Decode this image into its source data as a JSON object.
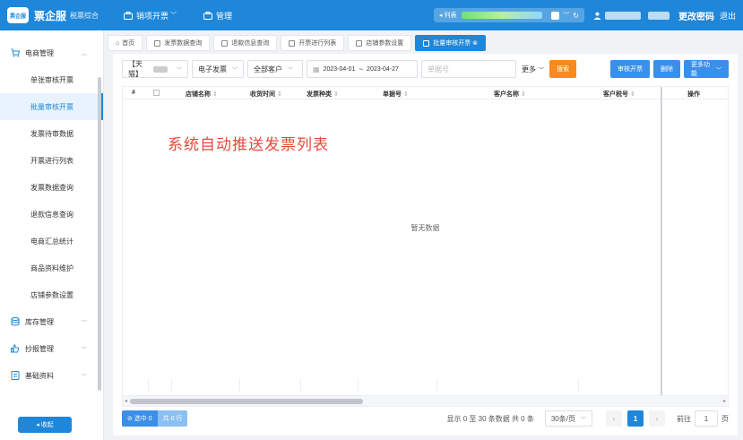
{
  "header": {
    "logo_text": "票企服",
    "app_name": "票企服",
    "app_sub": "税票综合",
    "nav": [
      {
        "label": "销项开票",
        "icon": "briefcase-icon",
        "caret": "﹀"
      },
      {
        "label": "管理",
        "icon": "briefcase-icon"
      }
    ],
    "list_label": "◂ 列表",
    "change_pwd": "更改密码",
    "logout": "退出"
  },
  "sidebar": {
    "groups": [
      {
        "label": "电商管理",
        "icon": "cart-icon",
        "items": [
          "单张审核开票",
          "批量审核开票",
          "发票待审数据",
          "开票进行列表",
          "发票数据查询",
          "退款信息查询",
          "电商汇总统计",
          "商品资料维护",
          "店铺参数设置"
        ]
      },
      {
        "label": "库存管理",
        "icon": "database-icon"
      },
      {
        "label": "抄报管理",
        "icon": "hand-icon"
      },
      {
        "label": "基础资料",
        "icon": "doc-icon"
      }
    ],
    "active_item": "批量审核开票",
    "collapse_label": "◂ 收起"
  },
  "tabs": [
    {
      "label": "首页",
      "active": false
    },
    {
      "label": "发票数据查询",
      "active": false
    },
    {
      "label": "退款信息查询",
      "active": false
    },
    {
      "label": "开票进行列表",
      "active": false
    },
    {
      "label": "店铺参数设置",
      "active": false
    },
    {
      "label": "批量审核开票 ⊗",
      "active": true
    }
  ],
  "filters": {
    "shop": "【天猫】",
    "invoice_type": "电子发票",
    "customer": "全部客户",
    "date_from": "2023-04-01",
    "date_sep": "~",
    "date_to": "2023-04-27",
    "order_placeholder": "单据号",
    "more": "更多",
    "search": "搜索",
    "audit_btn": "审核开票",
    "delete_btn": "删除",
    "more_btn": "更多功能"
  },
  "table": {
    "columns": [
      "#",
      "店铺名称",
      "收货时间",
      "发票种类",
      "单据号",
      "客户名称",
      "客户税号",
      "操作"
    ],
    "empty": "暂无数据",
    "overlay": "系统自动推送发票列表"
  },
  "footer": {
    "selected": "⊘ 选中 0",
    "total_rows": "共 0 行",
    "summary": "显示 0 至 30 条数据  共 0 条",
    "page_size": "30条/页",
    "current_page": "1",
    "prev": "‹",
    "next": "›",
    "goto_label": "前往",
    "goto_value": "1",
    "page_unit": "页"
  },
  "colors": {
    "brand": "#1e87d9",
    "orange": "#f68b1f",
    "accent_red": "#e84a3a"
  }
}
